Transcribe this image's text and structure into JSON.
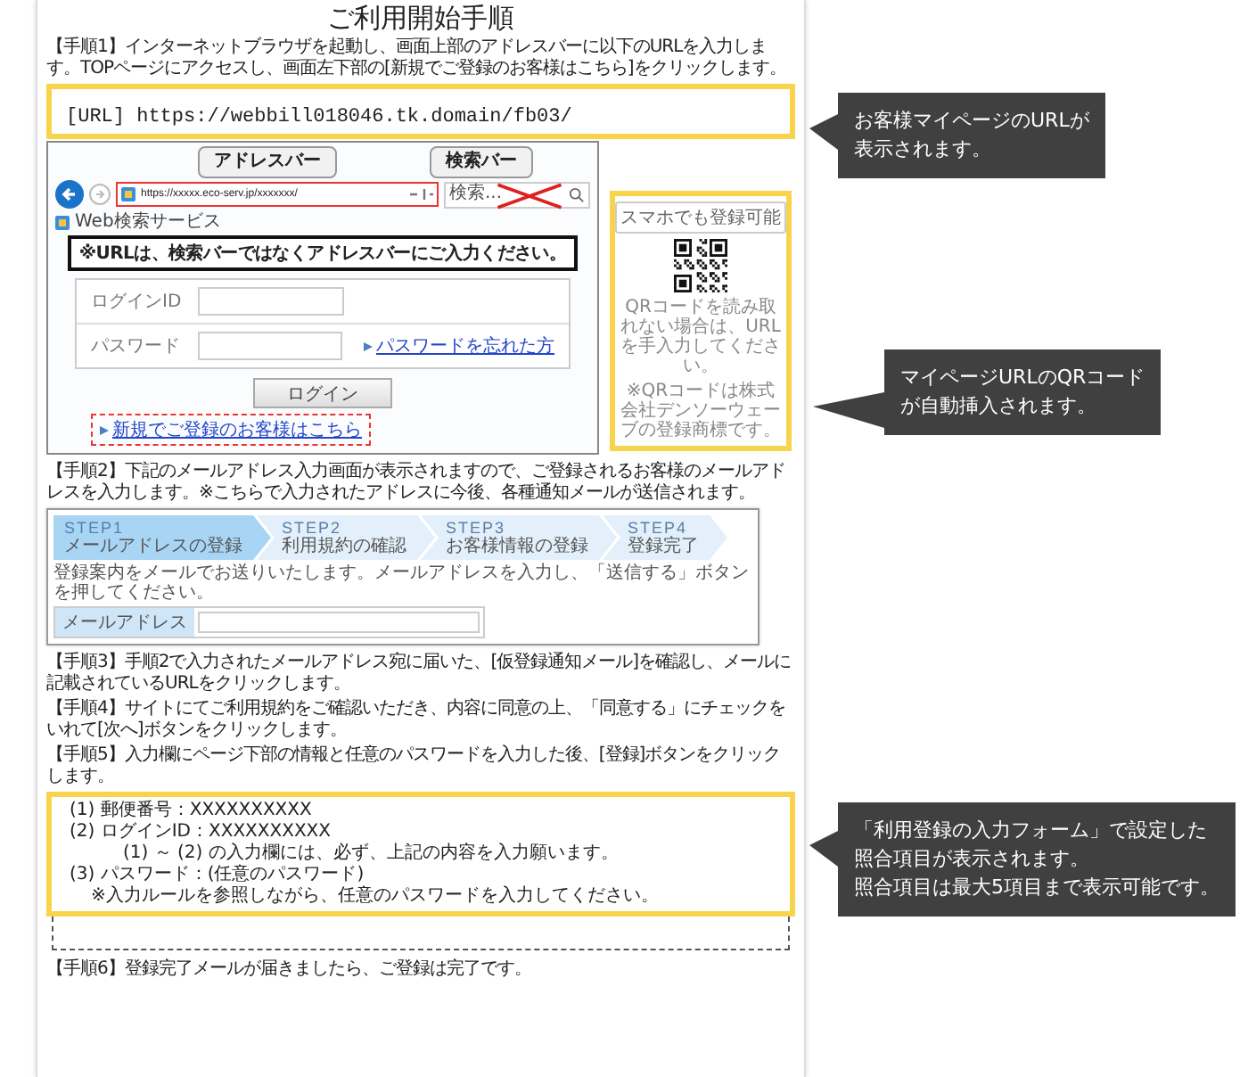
{
  "title": "ご利用開始手順",
  "step1": {
    "text": "【手順1】インターネットブラウザを起動し、画面上部のアドレスバーに以下のURLを入力します。TOPページにアクセスし、画面左下部の[新規でご登録のお客様はこちら]をクリックします。",
    "url": "[URL] https://webbill018046.tk.domain/fb03/"
  },
  "login_screenshot": {
    "balloons": [
      "アドレスバー",
      "検索バー"
    ],
    "address": "https://xxxxx.eco-serv.jp/xxxxxxx/",
    "search_placeholder": "検索...",
    "tab": "Web検索サービス",
    "warning": "※URLは、検索バーではなくアドレスバーにご入力ください。",
    "fields": [
      {
        "label": "ログインID"
      },
      {
        "label": "パスワード",
        "link": "パスワードを忘れた方"
      }
    ],
    "login_button": "ログイン",
    "new_link": "新規でご登録のお客様はこちら"
  },
  "qr_panel": {
    "label": "スマホでも登録可能",
    "note": "QRコードを読み取れない場合は、URLを手入力してください。",
    "trademark": "※QRコードは株式会社デンソーウェーブの登録商標です。"
  },
  "step2": {
    "text": "【手順2】下記のメールアドレス入力画面が表示されますので、ご登録されるお客様のメールアドレスを入力します。※こちらで入力されたアドレスに今後、各種通知メールが送信されます。",
    "wizard": [
      {
        "label": "STEP1",
        "caption": "メールアドレスの登録",
        "selected": true
      },
      {
        "label": "STEP2",
        "caption": "利用規約の確認",
        "selected": false
      },
      {
        "label": "STEP3",
        "caption": "お客様情報の登録",
        "selected": false
      },
      {
        "label": "STEP4",
        "caption": "登録完了",
        "selected": false
      }
    ],
    "notice": "登録案内をメールでお送りいたします。メールアドレスを入力し、「送信する」ボタンを押してください。",
    "email_label": "メールアドレス"
  },
  "step3": "【手順3】手順2で入力されたメールアドレス宛に届いた、[仮登録通知メール]を確認し、メールに記載されているURLをクリックします。",
  "step4": "【手順4】サイトにてご利用規約をご確認いただき、内容に同意の上、「同意する」にチェックをいれて[次へ]ボタンをクリックします。",
  "step5": {
    "text": "【手順5】入力欄にページ下部の情報と任意のパスワードを入力した後、[登録]ボタンをクリックします。",
    "lines": [
      {
        "kind": "item",
        "text": "(1) 郵便番号：XXXXXXXXXX"
      },
      {
        "kind": "item",
        "text": "(2) ログインID：XXXXXXXXXX"
      },
      {
        "kind": "note",
        "text": "(1) ～ (2) の入力欄には、必ず、上記の内容を入力願います。"
      },
      {
        "kind": "item",
        "text": "(3) パスワード：(任意のパスワード)"
      },
      {
        "kind": "subnote",
        "text": "※入力ルールを参照しながら、任意のパスワードを入力してください。"
      }
    ]
  },
  "step6": "【手順6】登録完了メールが届きましたら、ご登録は完了です。",
  "callouts": [
    {
      "lines": [
        "お客様マイページのURLが",
        "表示されます。"
      ]
    },
    {
      "lines": [
        "マイページURLのQRコード",
        "が自動挿入されます。"
      ]
    },
    {
      "lines": [
        "「利用登録の入力フォーム」で設定した",
        "照合項目が表示されます。",
        "照合項目は最大5項目まで表示可能です。"
      ]
    }
  ]
}
